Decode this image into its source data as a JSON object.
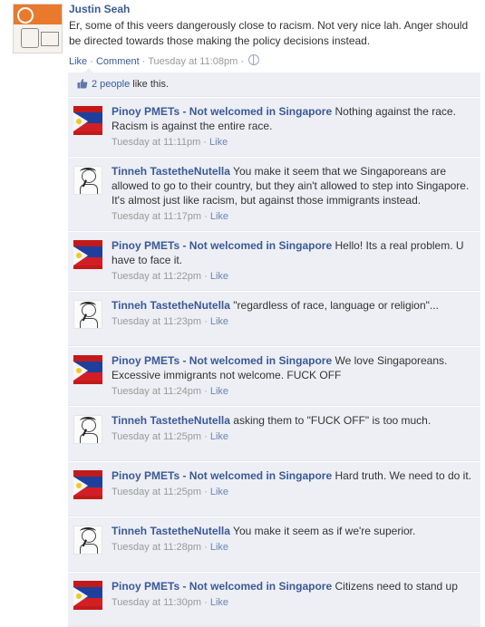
{
  "post": {
    "author": "Justin Seah",
    "text": "Er, some of this veers dangerously close to racism. Not very nice lah. Anger should be directed towards those making the policy decisions instead.",
    "like_label": "Like",
    "comment_label": "Comment",
    "sep": " · ",
    "time": "Tuesday at 11:08pm",
    "privacy_icon": "globe-icon"
  },
  "likes": {
    "icon": "thumbs-up-icon",
    "count_label": "2 people",
    "suffix": "like this."
  },
  "comments": [
    {
      "author": "Pinoy PMETs - Not welcomed in Singapore",
      "text": "Nothing against the race. Racism is against the entire race.",
      "time": "Tuesday at 11:11pm",
      "like": "Like",
      "avatar": "flag"
    },
    {
      "author": "Tinneh TastetheNutella",
      "text": "You make it seem that we Singaporeans are allowed to go to their country, but they ain't allowed to step into Singapore.\nIt's almost just like racism, but against those immigrants instead.",
      "time": "Tuesday at 11:17pm",
      "like": "Like",
      "avatar": "sketch"
    },
    {
      "author": "Pinoy PMETs - Not welcomed in Singapore",
      "text": "Hello! Its a real problem. U have to face it.",
      "time": "Tuesday at 11:22pm",
      "like": "Like",
      "avatar": "flag"
    },
    {
      "author": "Tinneh TastetheNutella",
      "text": "\"regardless of race, language or religion\"...",
      "time": "Tuesday at 11:23pm",
      "like": "Like",
      "avatar": "sketch"
    },
    {
      "author": "Pinoy PMETs - Not welcomed in Singapore",
      "text": "We love Singaporeans. Excessive immigrants not welcome. FUCK OFF",
      "time": "Tuesday at 11:24pm",
      "like": "Like",
      "avatar": "flag"
    },
    {
      "author": "Tinneh TastetheNutella",
      "text": "asking them to \"FUCK OFF\" is too much.",
      "time": "Tuesday at 11:25pm",
      "like": "Like",
      "avatar": "sketch"
    },
    {
      "author": "Pinoy PMETs - Not welcomed in Singapore",
      "text": "Hard truth. We need to do it.",
      "time": "Tuesday at 11:25pm",
      "like": "Like",
      "avatar": "flag"
    },
    {
      "author": "Tinneh TastetheNutella",
      "text": "You make it seem as if we're superior.",
      "time": "Tuesday at 11:28pm",
      "like": "Like",
      "avatar": "sketch"
    },
    {
      "author": "Pinoy PMETs - Not welcomed in Singapore",
      "text": "Citizens need to stand up",
      "time": "Tuesday at 11:30pm",
      "like": "Like",
      "avatar": "flag"
    }
  ]
}
